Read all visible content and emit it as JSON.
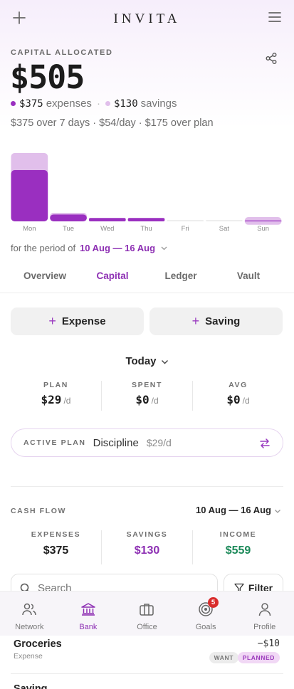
{
  "app": {
    "title": "INVITA"
  },
  "capital": {
    "label": "CAPITAL ALLOCATED",
    "amount": "$505",
    "expenses_amount": "$375",
    "expenses_word": "expenses",
    "savings_amount": "$130",
    "savings_word": "savings",
    "summary": "$375 over 7 days · $54/day · $175 over plan"
  },
  "chart_data": {
    "type": "bar",
    "categories": [
      "Mon",
      "Tue",
      "Wed",
      "Thu",
      "Fri",
      "Sat",
      "Sun"
    ],
    "series": [
      {
        "name": "expenses",
        "values": [
          300,
          40,
          20,
          20,
          0,
          0,
          5
        ]
      },
      {
        "name": "savings",
        "values": [
          100,
          10,
          0,
          0,
          0,
          0,
          20
        ]
      }
    ],
    "ylim": [
      0,
      400
    ],
    "colors": {
      "expenses": "#9a2fc0",
      "savings": "#e1bfeb",
      "empty": "#eeeeee"
    }
  },
  "period": {
    "prefix": "for the period of",
    "range": "10 Aug — 16 Aug"
  },
  "tabs": [
    {
      "label": "Overview",
      "active": false
    },
    {
      "label": "Capital",
      "active": true
    },
    {
      "label": "Ledger",
      "active": false
    },
    {
      "label": "Vault",
      "active": false
    }
  ],
  "actions": {
    "expense_label": "Expense",
    "saving_label": "Saving"
  },
  "today": {
    "label": "Today"
  },
  "daily": [
    {
      "key": "PLAN",
      "value": "$29",
      "unit": "/d"
    },
    {
      "key": "SPENT",
      "value": "$0",
      "unit": "/d"
    },
    {
      "key": "AVG",
      "value": "$0",
      "unit": "/d"
    }
  ],
  "active_plan": {
    "key": "ACTIVE PLAN",
    "name": "Discipline",
    "rate": "$29/d"
  },
  "cash_flow": {
    "label": "CASH FLOW",
    "range": "10 Aug — 16 Aug",
    "expenses_key": "EXPENSES",
    "expenses_value": "$375",
    "savings_key": "SAVINGS",
    "savings_value": "$130",
    "income_key": "INCOME",
    "income_value": "$559"
  },
  "search": {
    "placeholder": "Search"
  },
  "filter": {
    "label": "Filter"
  },
  "nav": [
    {
      "label": "Network",
      "icon": "people-icon",
      "active": false
    },
    {
      "label": "Bank",
      "icon": "bank-icon",
      "active": true
    },
    {
      "label": "Office",
      "icon": "briefcase-icon",
      "active": false
    },
    {
      "label": "Goals",
      "icon": "target-icon",
      "active": false,
      "badge": "5"
    },
    {
      "label": "Profile",
      "icon": "person-icon",
      "active": false
    }
  ],
  "ledger": [
    {
      "title": "Groceries",
      "subtitle": "Expense",
      "amount": "−$10",
      "tags": [
        "WANT",
        "PLANNED"
      ]
    },
    {
      "title": "Saving"
    }
  ],
  "colors": {
    "accent": "#8d2fb3",
    "income": "#1d8a5a"
  }
}
